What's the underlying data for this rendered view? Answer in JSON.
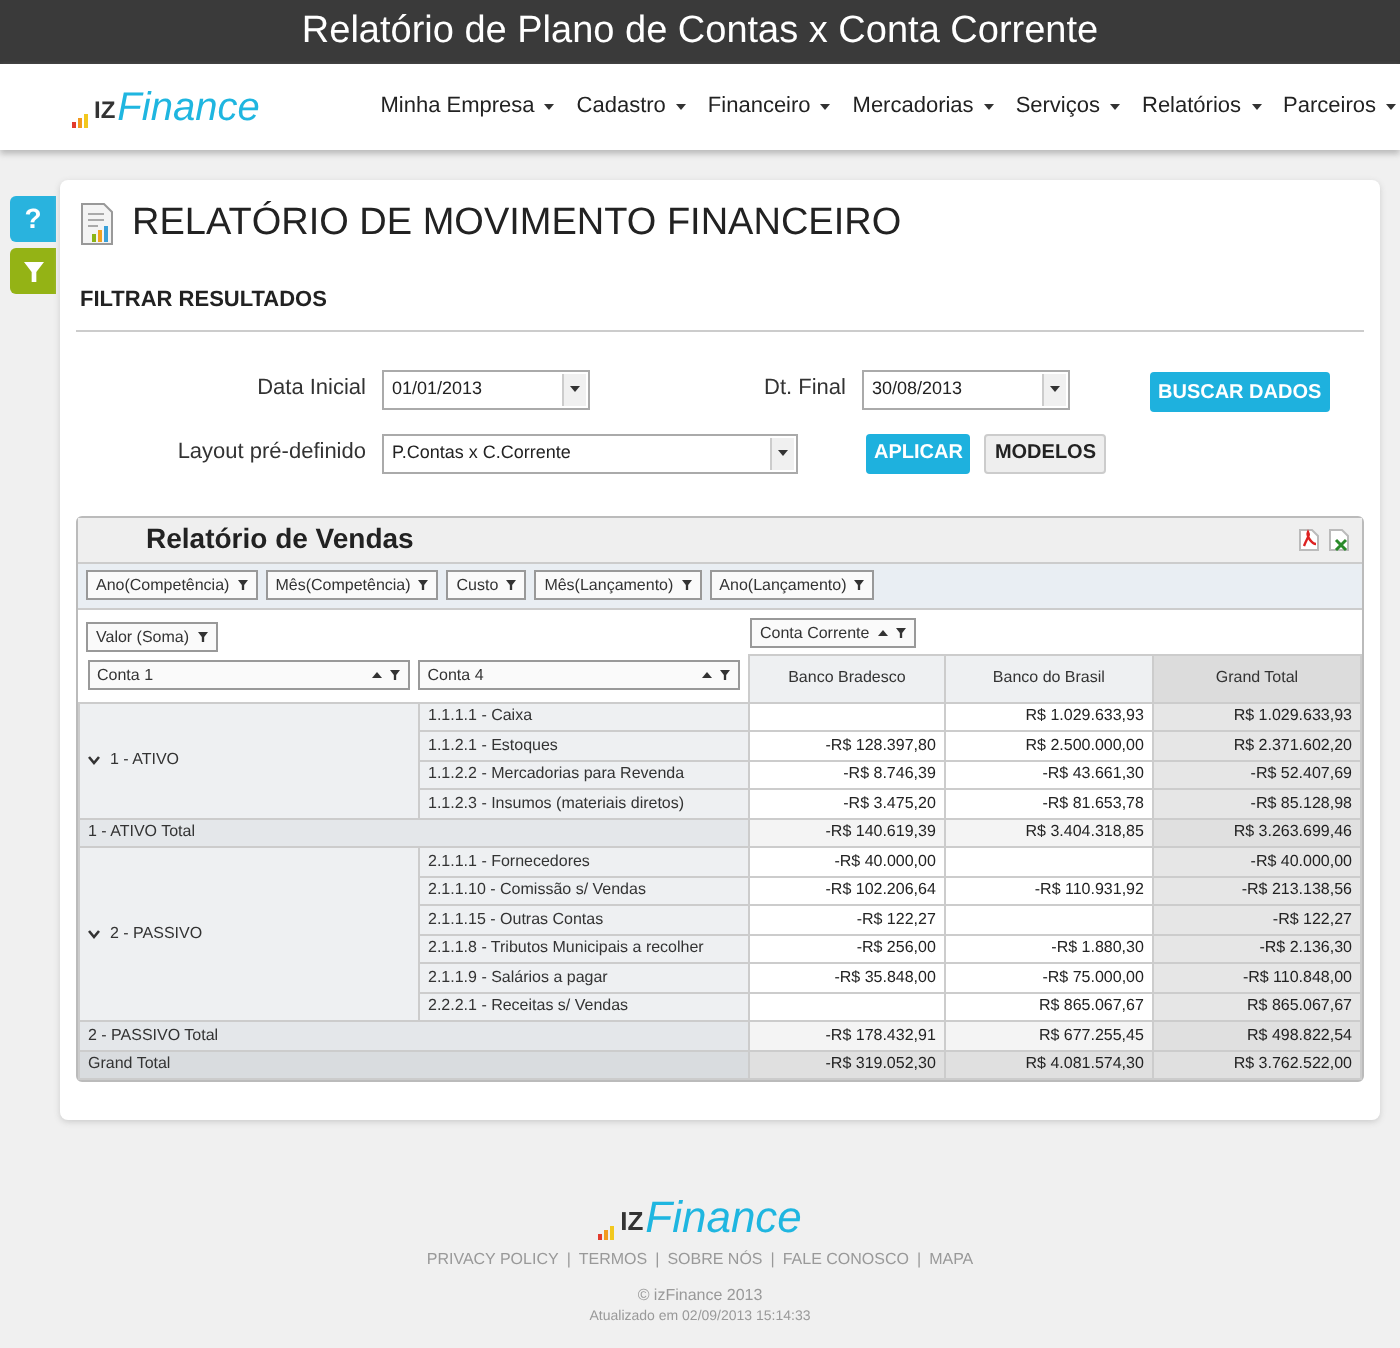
{
  "page_title": "Relatório de Plano de Contas x Conta Corrente",
  "logo": {
    "prefix": "IZ",
    "name": "Finance"
  },
  "nav": [
    "Minha Empresa",
    "Cadastro",
    "Financeiro",
    "Mercadorias",
    "Serviços",
    "Relatórios",
    "Parceiros"
  ],
  "side_buttons": [
    {
      "kind": "help",
      "label": "?"
    },
    {
      "kind": "filter"
    }
  ],
  "heading": "RELATÓRIO DE MOVIMENTO FINANCEIRO",
  "filter": {
    "title": "FILTRAR RESULTADOS",
    "start_date": {
      "label": "Data Inicial",
      "value": "01/01/2013"
    },
    "end_date": {
      "label": "Dt. Final",
      "value": "30/08/2013"
    },
    "layout": {
      "label": "Layout pré-definido",
      "value": "P.Contas x C.Corrente"
    },
    "buttons": [
      {
        "kind": "primary",
        "label": "BUSCAR DADOS"
      },
      {
        "kind": "primary",
        "label": "APLICAR"
      },
      {
        "kind": "secondary",
        "label": "MODELOS"
      }
    ]
  },
  "report": {
    "title": "Relatório de Vendas",
    "filter_fields": [
      "Ano(Competência)",
      "Mês(Competência)",
      "Custo",
      "Mês(Lançamento)",
      "Ano(Lançamento)"
    ],
    "data_field": "Valor (Soma)",
    "column_field": "Conta Corrente",
    "row_fields": [
      "Conta 1",
      "Conta 4"
    ],
    "columns": {
      "column_1": "Banco Bradesco",
      "column_2": "Banco do Brasil",
      "column_3": "Grand Total"
    },
    "groups": [
      {
        "label": "1 - ATIVO",
        "expanded": true,
        "rows": [
          {
            "account": "1.1.1.1 - Caixa",
            "column_2": "R$ 1.029.633,93",
            "column_3": "R$ 1.029.633,93"
          },
          {
            "account": "1.1.2.1 - Estoques",
            "column_1": "-R$ 128.397,80",
            "column_2": "R$ 2.500.000,00",
            "column_3": "R$ 2.371.602,20"
          },
          {
            "account": "1.1.2.2 - Mercadorias para Revenda",
            "column_1": "-R$ 8.746,39",
            "column_2": "-R$ 43.661,30",
            "column_3": "-R$ 52.407,69"
          },
          {
            "account": "1.1.2.3 - Insumos (materiais diretos)",
            "column_1": "-R$ 3.475,20",
            "column_2": "-R$ 81.653,78",
            "column_3": "-R$ 85.128,98"
          }
        ],
        "total": {
          "label": "1 - ATIVO Total",
          "column_1": "-R$ 140.619,39",
          "column_2": "R$ 3.404.318,85",
          "column_3": "R$ 3.263.699,46"
        }
      },
      {
        "label": "2 - PASSIVO",
        "expanded": true,
        "rows": [
          {
            "account": "2.1.1.1 - Fornecedores",
            "column_1": "-R$ 40.000,00",
            "column_3": "-R$ 40.000,00"
          },
          {
            "account": "2.1.1.10 - Comissão s/ Vendas",
            "column_1": "-R$ 102.206,64",
            "column_2": "-R$ 110.931,92",
            "column_3": "-R$ 213.138,56"
          },
          {
            "account": "2.1.1.15 - Outras Contas",
            "column_1": "-R$ 122,27",
            "column_3": "-R$ 122,27"
          },
          {
            "account": "2.1.1.8 - Tributos Municipais a recolher",
            "column_1": "-R$ 256,00",
            "column_2": "-R$ 1.880,30",
            "column_3": "-R$ 2.136,30"
          },
          {
            "account": "2.1.1.9 - Salários a pagar",
            "column_1": "-R$ 35.848,00",
            "column_2": "-R$ 75.000,00",
            "column_3": "-R$ 110.848,00"
          },
          {
            "account": "2.2.2.1 - Receitas s/ Vendas",
            "column_2": "R$ 865.067,67",
            "column_3": "R$ 865.067,67"
          }
        ],
        "total": {
          "label": "2 - PASSIVO Total",
          "column_1": "-R$ 178.432,91",
          "column_2": "R$ 677.255,45",
          "column_3": "R$ 498.822,54"
        }
      }
    ],
    "grand_total": {
      "label": "Grand Total",
      "column_1": "-R$ 319.052,30",
      "column_2": "R$ 4.081.574,30",
      "column_3": "R$ 3.762.522,00"
    }
  },
  "footer": {
    "logo": {
      "prefix": "IZ",
      "name": "Finance"
    },
    "links": [
      "PRIVACY POLICY",
      "TERMOS",
      "SOBRE NÓS",
      "FALE CONOSCO",
      "MAPA"
    ],
    "separator": "|",
    "copyright": "© izFinance 2013",
    "updated": "Atualizado em 02/09/2013 15:14:33"
  }
}
